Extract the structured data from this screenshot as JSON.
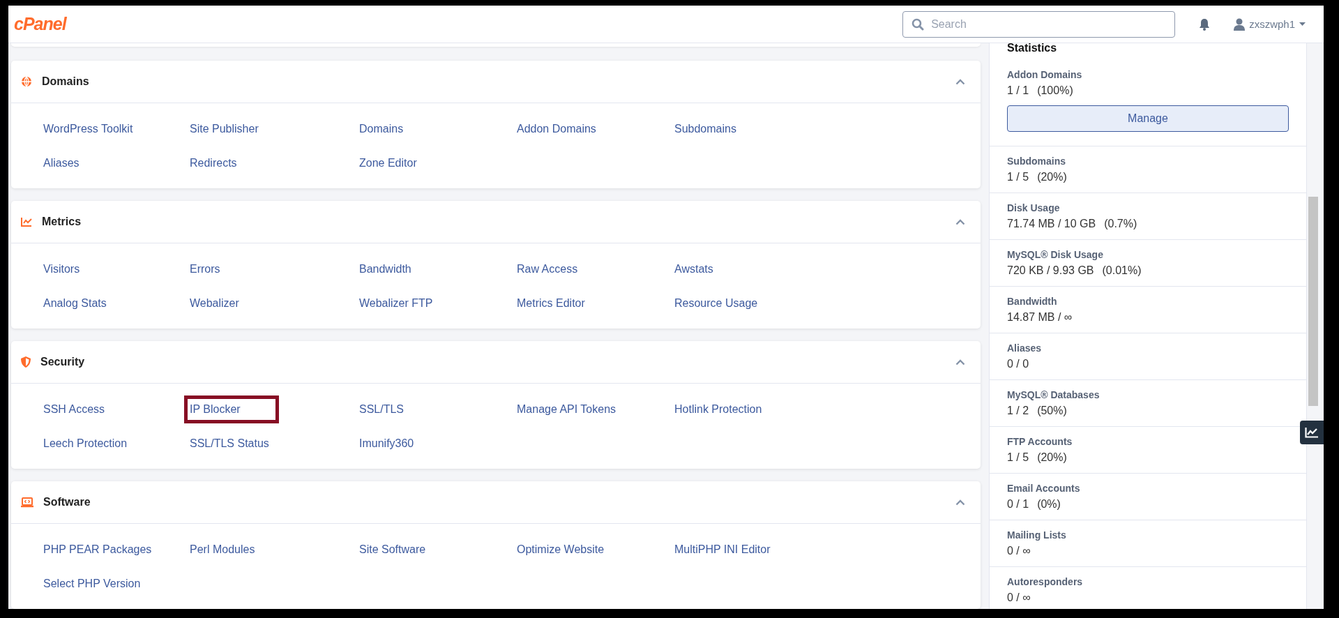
{
  "header": {
    "logo": "cPanel",
    "search": {
      "placeholder": "Search"
    },
    "user": {
      "name": "zxszwph1"
    }
  },
  "sections": [
    {
      "title": "Domains",
      "expanded": true,
      "links": [
        {
          "label": "WordPress Toolkit",
          "highlighted": false
        },
        {
          "label": "Site Publisher",
          "highlighted": false
        },
        {
          "label": "Domains",
          "highlighted": false
        },
        {
          "label": "Addon Domains",
          "highlighted": false
        },
        {
          "label": "Subdomains",
          "highlighted": false
        },
        {
          "label": "Aliases",
          "highlighted": false
        },
        {
          "label": "Redirects",
          "highlighted": false
        },
        {
          "label": "Zone Editor",
          "highlighted": false
        }
      ]
    },
    {
      "title": "Metrics",
      "expanded": true,
      "links": [
        {
          "label": "Visitors",
          "highlighted": false
        },
        {
          "label": "Errors",
          "highlighted": false
        },
        {
          "label": "Bandwidth",
          "highlighted": false
        },
        {
          "label": "Raw Access",
          "highlighted": false
        },
        {
          "label": "Awstats",
          "highlighted": false
        },
        {
          "label": "Analog Stats",
          "highlighted": false
        },
        {
          "label": "Webalizer",
          "highlighted": false
        },
        {
          "label": "Webalizer FTP",
          "highlighted": false
        },
        {
          "label": "Metrics Editor",
          "highlighted": false
        },
        {
          "label": "Resource Usage",
          "highlighted": false
        }
      ]
    },
    {
      "title": "Security",
      "expanded": true,
      "links": [
        {
          "label": "SSH Access",
          "highlighted": false
        },
        {
          "label": "IP Blocker",
          "highlighted": true
        },
        {
          "label": "SSL/TLS",
          "highlighted": false
        },
        {
          "label": "Manage API Tokens",
          "highlighted": false
        },
        {
          "label": "Hotlink Protection",
          "highlighted": false
        },
        {
          "label": "Leech Protection",
          "highlighted": false
        },
        {
          "label": "SSL/TLS Status",
          "highlighted": false
        },
        {
          "label": "Imunify360",
          "highlighted": false
        }
      ]
    },
    {
      "title": "Software",
      "expanded": true,
      "links": [
        {
          "label": "PHP PEAR Packages",
          "highlighted": false
        },
        {
          "label": "Perl Modules",
          "highlighted": false
        },
        {
          "label": "Site Software",
          "highlighted": false
        },
        {
          "label": "Optimize Website",
          "highlighted": false
        },
        {
          "label": "MultiPHP INI Editor",
          "highlighted": false
        },
        {
          "label": "Select PHP Version",
          "highlighted": false
        }
      ]
    }
  ],
  "statistics": {
    "title": "Statistics",
    "items": [
      {
        "label": "Addon Domains",
        "usage": "1 / 1",
        "percent": "(100%)",
        "button": "Manage"
      },
      {
        "label": "Subdomains",
        "usage": "1 / 5",
        "percent": "(20%)"
      },
      {
        "label": "Disk Usage",
        "usage": "71.74 MB / 10 GB",
        "percent": "(0.7%)"
      },
      {
        "label": "MySQL® Disk Usage",
        "usage": "720 KB / 9.93 GB",
        "percent": "(0.01%)"
      },
      {
        "label": "Bandwidth",
        "usage": "14.87 MB / ∞"
      },
      {
        "label": "Aliases",
        "usage": "0 / 0"
      },
      {
        "label": "MySQL® Databases",
        "usage": "1 / 2",
        "percent": "(50%)"
      },
      {
        "label": "FTP Accounts",
        "usage": "1 / 5",
        "percent": "(20%)"
      },
      {
        "label": "Email Accounts",
        "usage": "0 / 1",
        "percent": "(0%)"
      },
      {
        "label": "Mailing Lists",
        "usage": "0 / ∞"
      },
      {
        "label": "Autoresponders",
        "usage": "0 / ∞"
      }
    ]
  }
}
